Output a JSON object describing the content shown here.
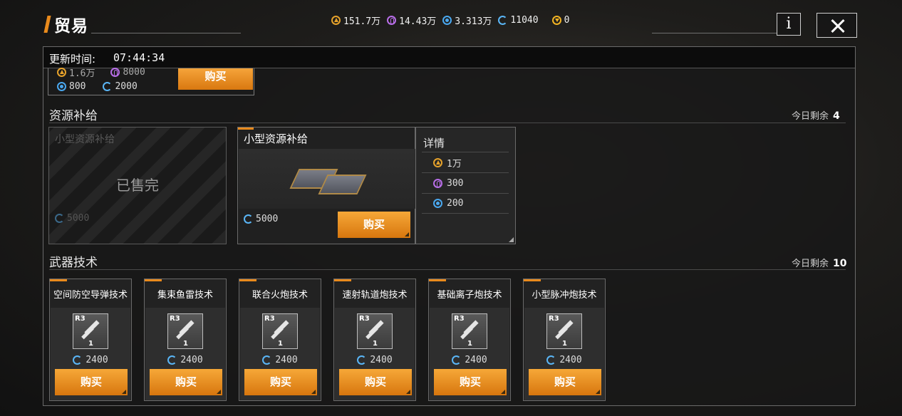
{
  "header": {
    "title": "贸易",
    "currencies": [
      {
        "icon": "gold-triangle-icon",
        "value": "151.7万"
      },
      {
        "icon": "purple-capsule-icon",
        "value": "14.43万"
      },
      {
        "icon": "blue-orb-icon",
        "value": "3.313万"
      },
      {
        "icon": "cycle-icon",
        "value": "11040"
      },
      {
        "icon": "yellow-shield-icon",
        "value": "0"
      }
    ],
    "info_label": "i"
  },
  "panel": {
    "update_label": "更新时间:",
    "update_time": "07:44:34",
    "previous_item": {
      "costs": [
        "1.6万",
        "8000",
        "800",
        "2000"
      ],
      "buy_label": "购买"
    }
  },
  "resource_supply": {
    "title": "资源补给",
    "remaining_label": "今日剩余",
    "remaining_count": "4",
    "sold_out_item": {
      "name": "小型资源补给",
      "status": "已售完",
      "price": "5000"
    },
    "item": {
      "name": "小型资源补给",
      "price": "5000",
      "buy_label": "购买"
    },
    "details": {
      "title": "详情",
      "rows": [
        {
          "icon": "gold-triangle-icon",
          "value": "1万"
        },
        {
          "icon": "purple-capsule-icon",
          "value": "300"
        },
        {
          "icon": "blue-orb-icon",
          "value": "200"
        }
      ]
    }
  },
  "weapon_tech": {
    "title": "武器技术",
    "remaining_label": "今日剩余",
    "remaining_count": "10",
    "items": [
      {
        "name": "空间防空导弹技术",
        "rank": "R3",
        "level": "1",
        "price": "2400",
        "buy_label": "购买"
      },
      {
        "name": "集束鱼雷技术",
        "rank": "R3",
        "level": "1",
        "price": "2400",
        "buy_label": "购买"
      },
      {
        "name": "联合火炮技术",
        "rank": "R3",
        "level": "1",
        "price": "2400",
        "buy_label": "购买"
      },
      {
        "name": "速射轨道炮技术",
        "rank": "R3",
        "level": "1",
        "price": "2400",
        "buy_label": "购买"
      },
      {
        "name": "基础离子炮技术",
        "rank": "R3",
        "level": "1",
        "price": "2400",
        "buy_label": "购买"
      },
      {
        "name": "小型脉冲炮技术",
        "rank": "R3",
        "level": "1",
        "price": "2400",
        "buy_label": "购买"
      }
    ]
  }
}
